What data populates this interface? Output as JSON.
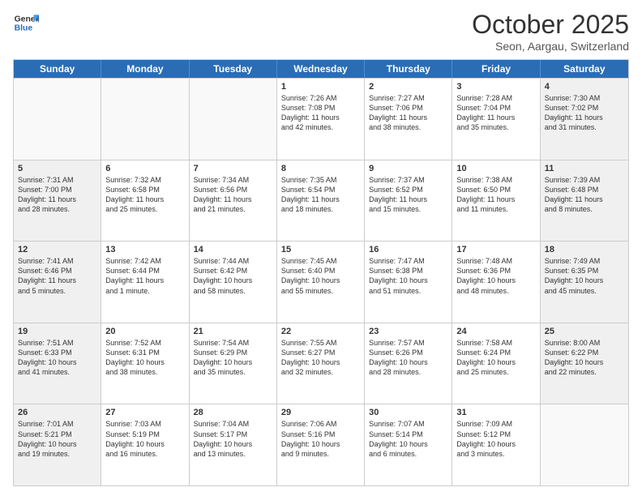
{
  "logo": {
    "text_general": "General",
    "text_blue": "Blue"
  },
  "header": {
    "month": "October 2025",
    "location": "Seon, Aargau, Switzerland"
  },
  "weekdays": [
    "Sunday",
    "Monday",
    "Tuesday",
    "Wednesday",
    "Thursday",
    "Friday",
    "Saturday"
  ],
  "rows": [
    [
      {
        "day": "",
        "info": "",
        "empty": true
      },
      {
        "day": "",
        "info": "",
        "empty": true
      },
      {
        "day": "",
        "info": "",
        "empty": true
      },
      {
        "day": "1",
        "info": "Sunrise: 7:26 AM\nSunset: 7:08 PM\nDaylight: 11 hours\nand 42 minutes."
      },
      {
        "day": "2",
        "info": "Sunrise: 7:27 AM\nSunset: 7:06 PM\nDaylight: 11 hours\nand 38 minutes."
      },
      {
        "day": "3",
        "info": "Sunrise: 7:28 AM\nSunset: 7:04 PM\nDaylight: 11 hours\nand 35 minutes."
      },
      {
        "day": "4",
        "info": "Sunrise: 7:30 AM\nSunset: 7:02 PM\nDaylight: 11 hours\nand 31 minutes.",
        "shaded": true
      }
    ],
    [
      {
        "day": "5",
        "info": "Sunrise: 7:31 AM\nSunset: 7:00 PM\nDaylight: 11 hours\nand 28 minutes.",
        "shaded": true
      },
      {
        "day": "6",
        "info": "Sunrise: 7:32 AM\nSunset: 6:58 PM\nDaylight: 11 hours\nand 25 minutes."
      },
      {
        "day": "7",
        "info": "Sunrise: 7:34 AM\nSunset: 6:56 PM\nDaylight: 11 hours\nand 21 minutes."
      },
      {
        "day": "8",
        "info": "Sunrise: 7:35 AM\nSunset: 6:54 PM\nDaylight: 11 hours\nand 18 minutes."
      },
      {
        "day": "9",
        "info": "Sunrise: 7:37 AM\nSunset: 6:52 PM\nDaylight: 11 hours\nand 15 minutes."
      },
      {
        "day": "10",
        "info": "Sunrise: 7:38 AM\nSunset: 6:50 PM\nDaylight: 11 hours\nand 11 minutes."
      },
      {
        "day": "11",
        "info": "Sunrise: 7:39 AM\nSunset: 6:48 PM\nDaylight: 11 hours\nand 8 minutes.",
        "shaded": true
      }
    ],
    [
      {
        "day": "12",
        "info": "Sunrise: 7:41 AM\nSunset: 6:46 PM\nDaylight: 11 hours\nand 5 minutes.",
        "shaded": true
      },
      {
        "day": "13",
        "info": "Sunrise: 7:42 AM\nSunset: 6:44 PM\nDaylight: 11 hours\nand 1 minute."
      },
      {
        "day": "14",
        "info": "Sunrise: 7:44 AM\nSunset: 6:42 PM\nDaylight: 10 hours\nand 58 minutes."
      },
      {
        "day": "15",
        "info": "Sunrise: 7:45 AM\nSunset: 6:40 PM\nDaylight: 10 hours\nand 55 minutes."
      },
      {
        "day": "16",
        "info": "Sunrise: 7:47 AM\nSunset: 6:38 PM\nDaylight: 10 hours\nand 51 minutes."
      },
      {
        "day": "17",
        "info": "Sunrise: 7:48 AM\nSunset: 6:36 PM\nDaylight: 10 hours\nand 48 minutes."
      },
      {
        "day": "18",
        "info": "Sunrise: 7:49 AM\nSunset: 6:35 PM\nDaylight: 10 hours\nand 45 minutes.",
        "shaded": true
      }
    ],
    [
      {
        "day": "19",
        "info": "Sunrise: 7:51 AM\nSunset: 6:33 PM\nDaylight: 10 hours\nand 41 minutes.",
        "shaded": true
      },
      {
        "day": "20",
        "info": "Sunrise: 7:52 AM\nSunset: 6:31 PM\nDaylight: 10 hours\nand 38 minutes."
      },
      {
        "day": "21",
        "info": "Sunrise: 7:54 AM\nSunset: 6:29 PM\nDaylight: 10 hours\nand 35 minutes."
      },
      {
        "day": "22",
        "info": "Sunrise: 7:55 AM\nSunset: 6:27 PM\nDaylight: 10 hours\nand 32 minutes."
      },
      {
        "day": "23",
        "info": "Sunrise: 7:57 AM\nSunset: 6:26 PM\nDaylight: 10 hours\nand 28 minutes."
      },
      {
        "day": "24",
        "info": "Sunrise: 7:58 AM\nSunset: 6:24 PM\nDaylight: 10 hours\nand 25 minutes."
      },
      {
        "day": "25",
        "info": "Sunrise: 8:00 AM\nSunset: 6:22 PM\nDaylight: 10 hours\nand 22 minutes.",
        "shaded": true
      }
    ],
    [
      {
        "day": "26",
        "info": "Sunrise: 7:01 AM\nSunset: 5:21 PM\nDaylight: 10 hours\nand 19 minutes.",
        "shaded": true
      },
      {
        "day": "27",
        "info": "Sunrise: 7:03 AM\nSunset: 5:19 PM\nDaylight: 10 hours\nand 16 minutes."
      },
      {
        "day": "28",
        "info": "Sunrise: 7:04 AM\nSunset: 5:17 PM\nDaylight: 10 hours\nand 13 minutes."
      },
      {
        "day": "29",
        "info": "Sunrise: 7:06 AM\nSunset: 5:16 PM\nDaylight: 10 hours\nand 9 minutes."
      },
      {
        "day": "30",
        "info": "Sunrise: 7:07 AM\nSunset: 5:14 PM\nDaylight: 10 hours\nand 6 minutes."
      },
      {
        "day": "31",
        "info": "Sunrise: 7:09 AM\nSunset: 5:12 PM\nDaylight: 10 hours\nand 3 minutes."
      },
      {
        "day": "",
        "info": "",
        "empty": true,
        "shaded": true
      }
    ]
  ]
}
